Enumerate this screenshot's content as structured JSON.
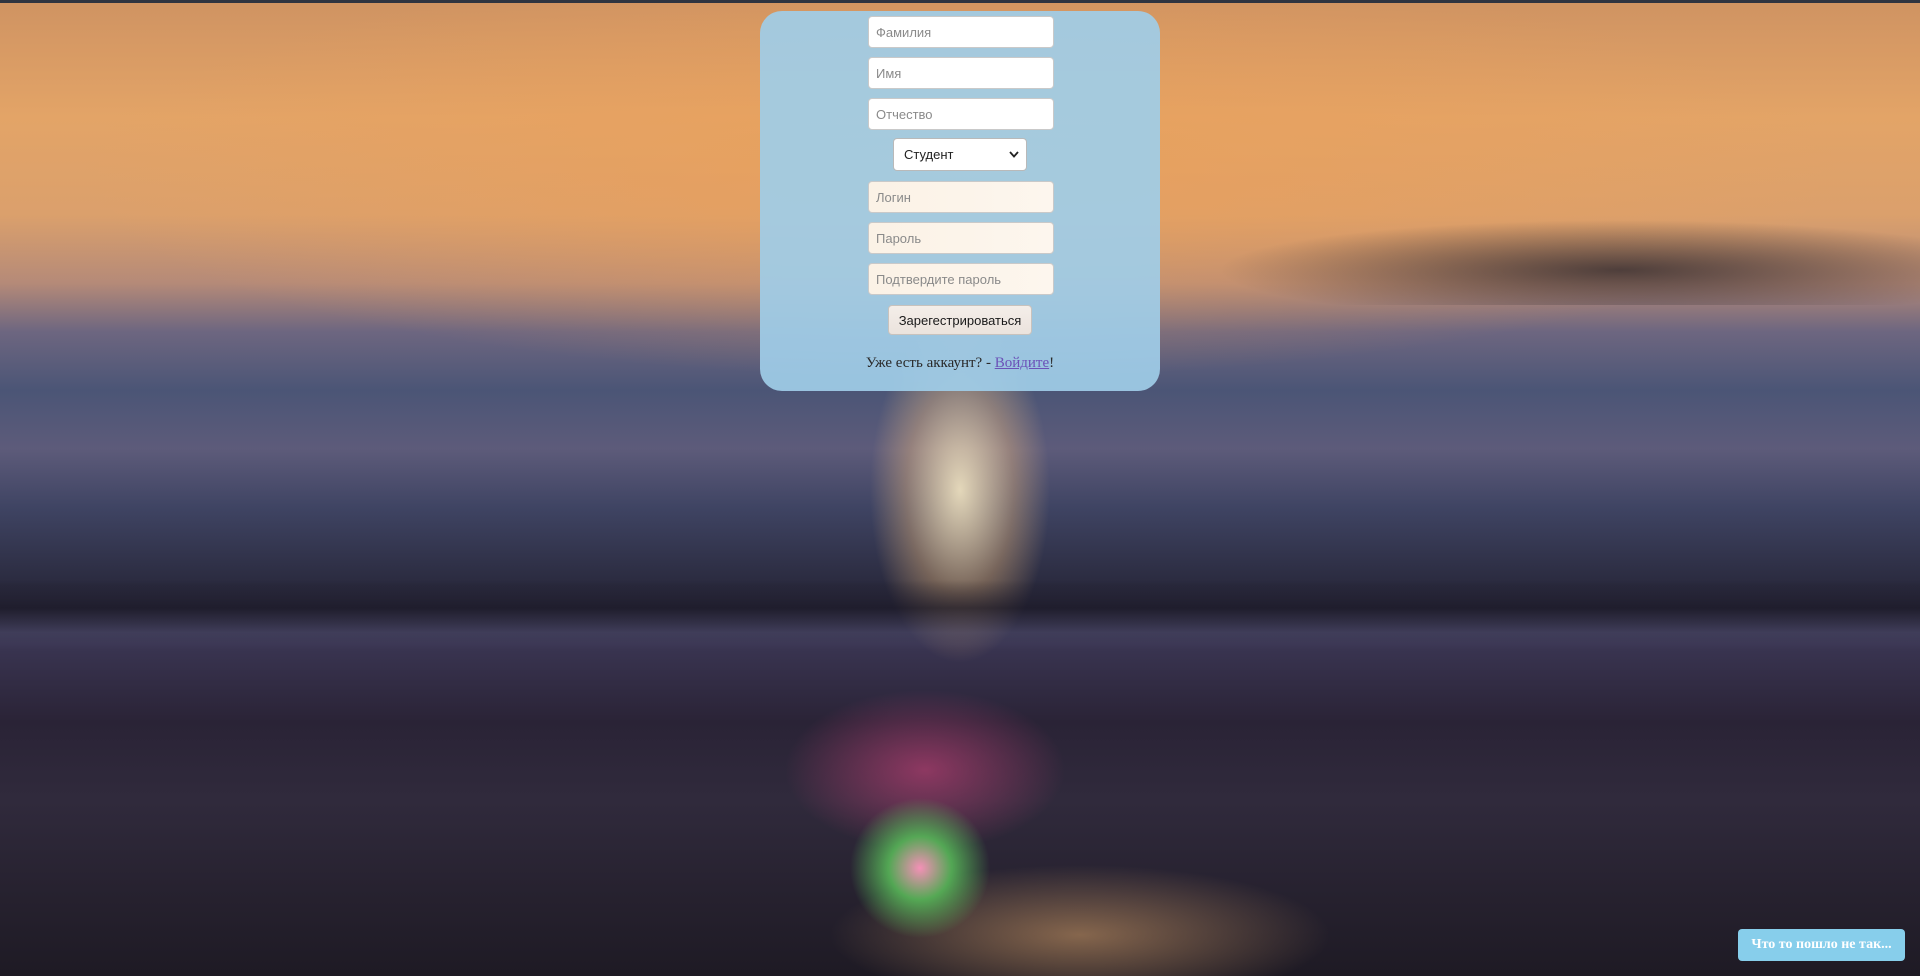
{
  "form": {
    "last_name_placeholder": "Фамилия",
    "first_name_placeholder": "Имя",
    "patronymic_placeholder": "Отчество",
    "role_selected": "Студент",
    "login_placeholder": "Логин",
    "password_placeholder": "Пароль",
    "confirm_password_placeholder": "Подтвердите пароль",
    "submit_label": "Зарегестрироваться"
  },
  "footer": {
    "have_account_text": "Уже есть аккаунт? - ",
    "login_link_text": "Войдите",
    "exclamation": "!"
  },
  "help_button": {
    "label": "Что то пошло не так..."
  },
  "colors": {
    "card_bg": "#a0cde8",
    "help_button_bg": "#87ceeb",
    "link": "#6b52b8"
  }
}
